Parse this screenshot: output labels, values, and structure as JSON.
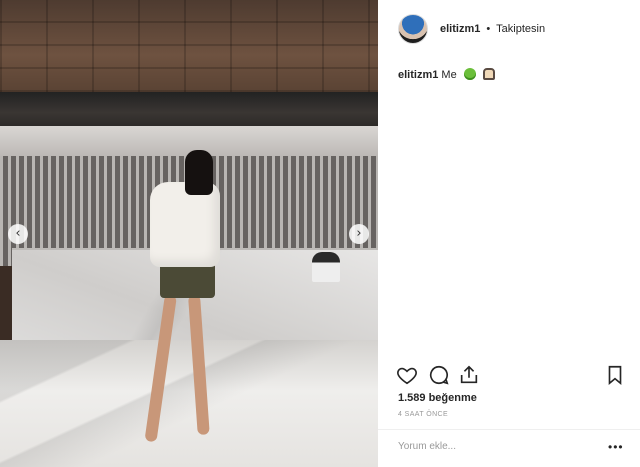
{
  "photo": {
    "nav_prev": "‹",
    "nav_next": "›"
  },
  "header": {
    "username": "elitizm1",
    "separator": "•",
    "follow_status": "Takiptesin"
  },
  "caption": {
    "username": "elitizm1",
    "text": "Me"
  },
  "stats": {
    "likes": "1.589 beğenme",
    "time": "4 SAAT ÖNCE"
  },
  "comment": {
    "placeholder": "Yorum ekle...",
    "more": "•••"
  },
  "icons": [
    "heart-icon",
    "comment-icon",
    "share-icon",
    "bookmark-icon",
    "chevron-left-icon",
    "chevron-right-icon"
  ]
}
